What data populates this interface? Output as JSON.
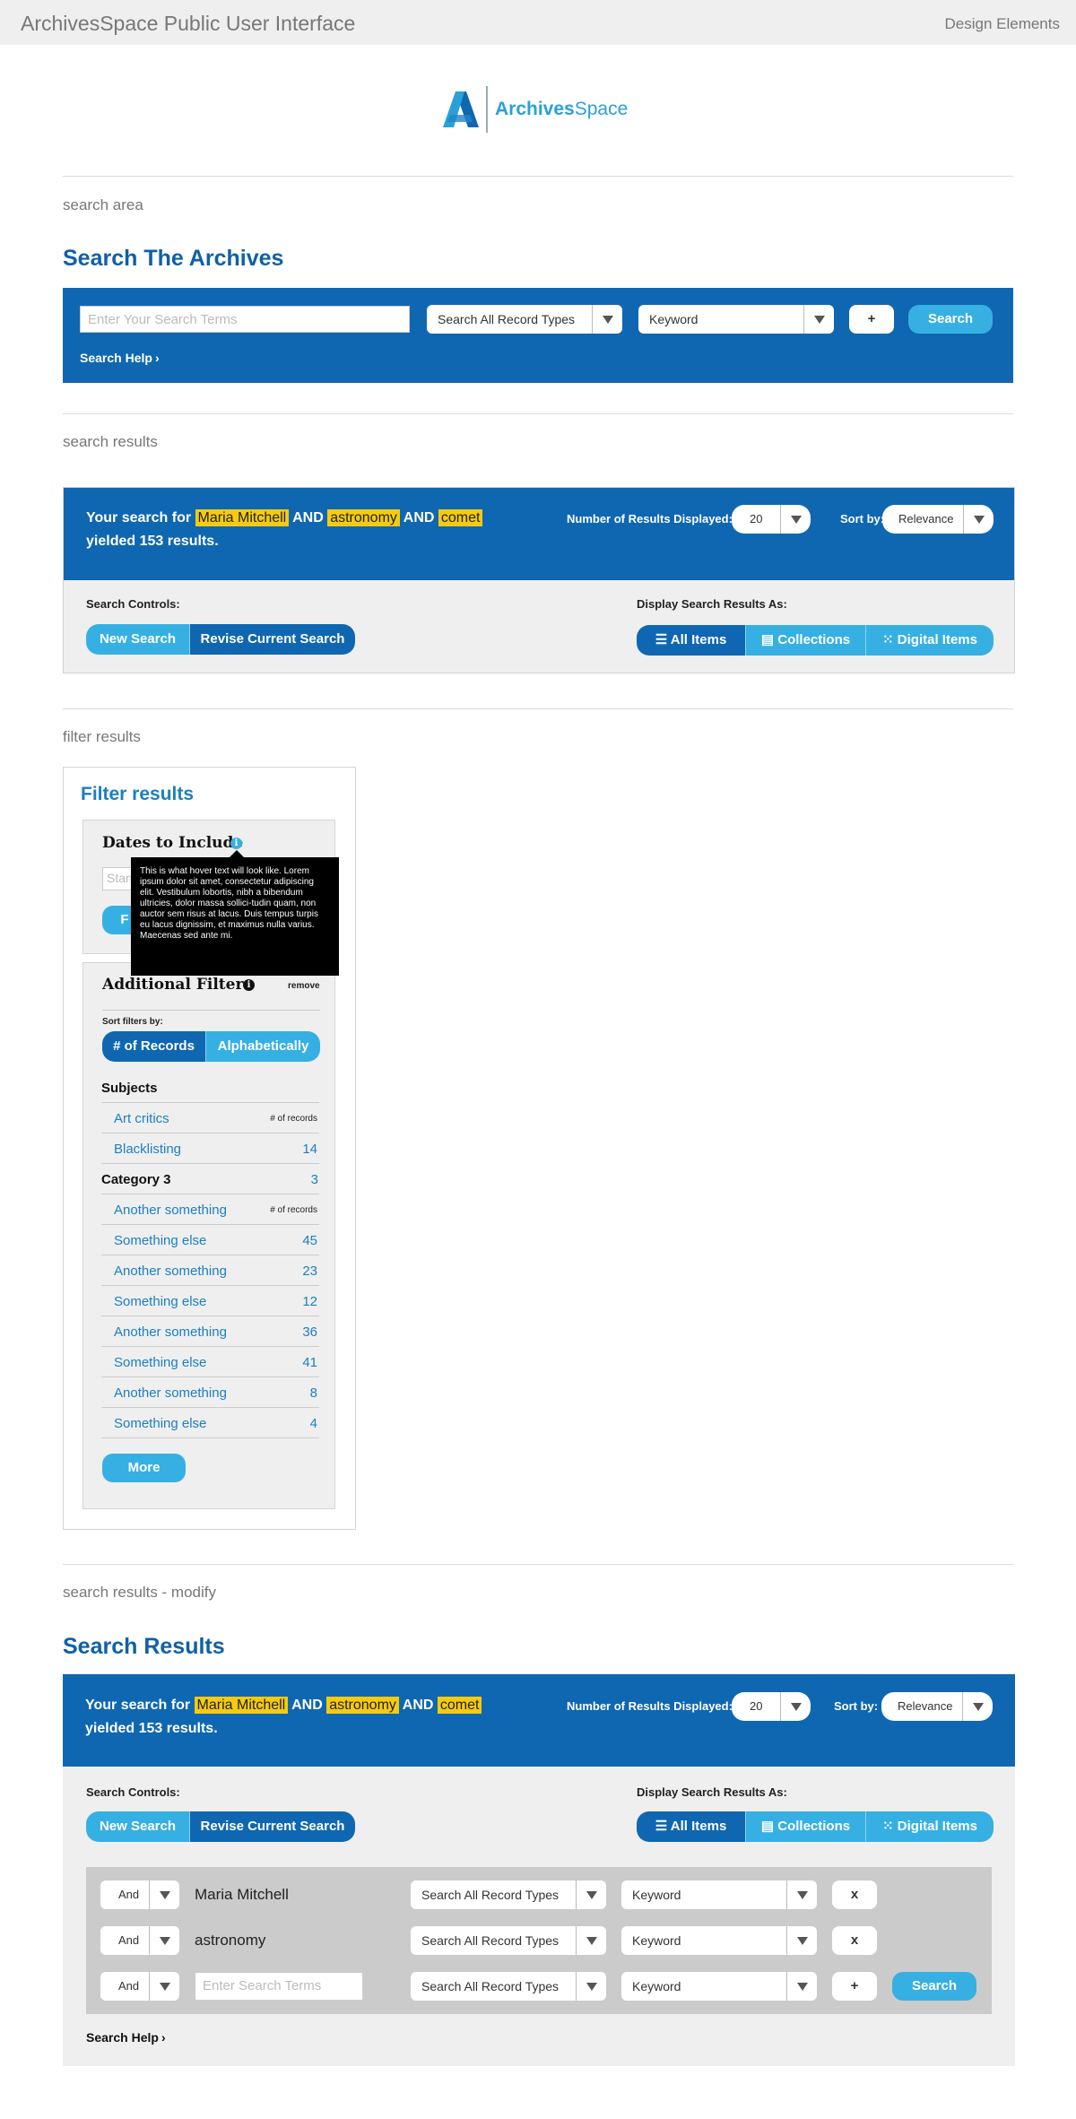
{
  "header": {
    "app_title": "ArchivesSpace Public User Interface",
    "design_link": "Design Elements"
  },
  "logo": {
    "word_bold": "Archives",
    "word_light": "Space",
    "colors": {
      "light": "#2aa0d8",
      "dark": "#0f67b1"
    }
  },
  "colors": {
    "brand_blue": "#0f67b1",
    "accent_cyan": "#36b0e3",
    "highlight_yellow": "#f6cb0f",
    "panel_gray": "#efefef"
  },
  "section1": {
    "label": "search area",
    "title": "Search The Archives",
    "search_placeholder": "Enter Your Search Terms",
    "record_type": "Search All Record Types",
    "field": "Keyword",
    "plus_label": "+",
    "search_label": "Search",
    "help_label": "Search Help"
  },
  "section2": {
    "label": "search results",
    "yield_prefix": "Your search for",
    "terms": [
      "Maria Mitchell",
      "astronomy",
      "comet"
    ],
    "and_label": "AND",
    "yield_line2": "yielded 153 results.",
    "results_displayed_label": "Number of Results Displayed:",
    "results_displayed_value": "20",
    "sort_label": "Sort by:",
    "sort_value": "Relevance",
    "controls_label": "Search Controls:",
    "new_search": "New Search",
    "revise_search": "Revise Current Search",
    "display_label": "Display Search Results As:",
    "view_all": "All Items",
    "view_collections": "Collections",
    "view_digital": "Digital Items"
  },
  "section3": {
    "label": "filter results",
    "filter_title": "Filter results",
    "dates_title": "Dates to Include",
    "dates_start_placeholder": "Start",
    "dates_button": "F",
    "tooltip": "This is what hover text will look like. Lorem ipsum dolor sit amet, consectetur adipiscing elit. Vestibulum lobortis, nibh a bibendum ultricies, dolor massa sollici-tudin quam, non auctor sem risus at lacus. Duis tempus turpis eu lacus dignissim, et maximus nulla varius. Maecenas sed ante mi.",
    "additional_title": "Additional Filters",
    "remove_label": "remove",
    "sort_filters_label": "Sort filters by:",
    "sort_records": "# of Records",
    "sort_alpha": "Alphabetically",
    "subjects_heading": "Subjects",
    "subjects": [
      {
        "label": "Art critics",
        "count": "# of records"
      },
      {
        "label": "Blacklisting",
        "count": "14"
      }
    ],
    "category3_heading": "Category 3",
    "category3_count": "3",
    "category3": [
      {
        "label": "Another something",
        "count": "# of records"
      },
      {
        "label": "Something else",
        "count": "45"
      },
      {
        "label": "Another something",
        "count": "23"
      },
      {
        "label": "Something else",
        "count": "12"
      },
      {
        "label": "Another something",
        "count": "36"
      },
      {
        "label": "Something else",
        "count": "41"
      },
      {
        "label": "Another something",
        "count": "8"
      },
      {
        "label": "Something else",
        "count": "4"
      }
    ],
    "more_label": "More"
  },
  "section4": {
    "label": "search results - modify",
    "title": "Search Results",
    "rows": [
      {
        "op": "And",
        "term": "Maria Mitchell",
        "record_type": "Search All Record Types",
        "field": "Keyword",
        "action": "x"
      },
      {
        "op": "And",
        "term": "astronomy",
        "record_type": "Search All Record Types",
        "field": "Keyword",
        "action": "x"
      },
      {
        "op": "And",
        "term_placeholder": "Enter Search Terms",
        "record_type": "Search All Record Types",
        "field": "Keyword",
        "action": "+",
        "search": "Search"
      }
    ],
    "help_label": "Search Help"
  }
}
